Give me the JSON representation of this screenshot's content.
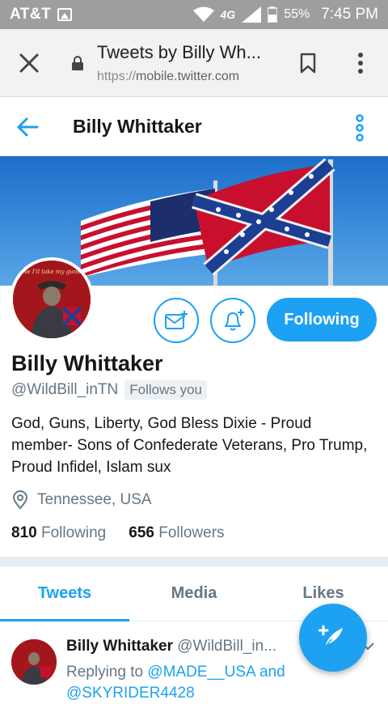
{
  "status_bar": {
    "carrier": "AT&T",
    "network": "4G",
    "battery": "55%",
    "time": "7:45 PM"
  },
  "browser": {
    "page_title": "Tweets by Billy Wh...",
    "url_scheme": "https://",
    "url_host": "mobile.twitter.com"
  },
  "header": {
    "name": "Billy Whittaker"
  },
  "avatar_caption": "I believe I'll take my guns today",
  "profile": {
    "name": "Billy Whittaker",
    "handle": "@WildBill_inTN",
    "follows_you": "Follows you",
    "bio": "God, Guns, Liberty, God Bless Dixie -  Proud member- Sons of Confederate Veterans, Pro Trump, Proud Infidel, Islam sux",
    "location": "Tennessee, USA",
    "following_count": "810",
    "following_label": "Following",
    "followers_count": "656",
    "followers_label": "Followers",
    "follow_button": "Following"
  },
  "tabs": [
    {
      "label": "Tweets",
      "active": true
    },
    {
      "label": "Media",
      "active": false
    },
    {
      "label": "Likes",
      "active": false
    }
  ],
  "tweet": {
    "name": "Billy Whittaker",
    "handle": "@WildBill_in...",
    "replying_prefix": "Replying to",
    "reply_to_1": "@MADE__USA",
    "reply_and": "and",
    "reply_to_2": "@SKYRIDER4428"
  },
  "colors": {
    "accent": "#1da1f2",
    "status_bar": "#9e9e9e",
    "secondary_text": "#657786"
  },
  "icons": {
    "close": "close-icon",
    "lock": "lock-icon",
    "bookmark": "bookmark-icon",
    "menu": "more-vert-icon",
    "back": "arrow-left-icon",
    "message": "message-icon",
    "notify": "bell-add-icon",
    "location": "location-pin-icon",
    "compose": "compose-tweet-icon"
  }
}
